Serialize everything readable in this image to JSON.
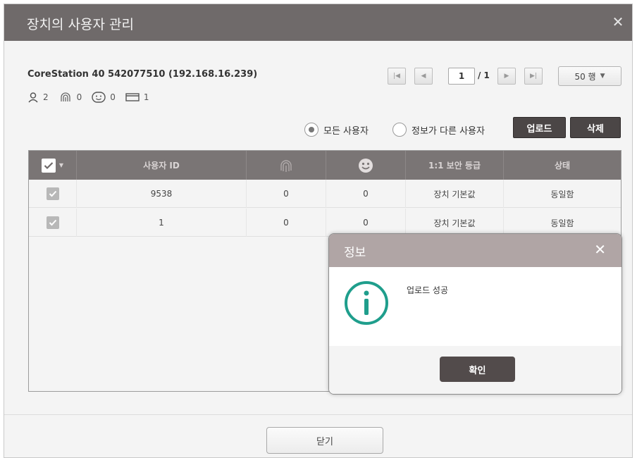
{
  "window": {
    "title": "장치의 사용자 관리",
    "close_glyph": "✕"
  },
  "device": {
    "name": "CoreStation 40 542077510 (192.168.16.239)",
    "counts": {
      "users": "2",
      "fingerprints": "0",
      "faces": "0",
      "cards": "1"
    }
  },
  "pagination": {
    "page": "1",
    "total": "/ 1",
    "rows_per_page": "50 행"
  },
  "filter": {
    "all_users": "모든 사용자",
    "different_users": "정보가 다른 사용자",
    "selected": "all_users"
  },
  "actions": {
    "upload": "업로드",
    "delete": "삭제"
  },
  "table": {
    "columns": [
      "사용자 ID",
      "fingerprint-icon",
      "face-icon",
      "1:1 보안 등급",
      "상태"
    ],
    "headers": {
      "user_id": "사용자 ID",
      "security": "1:1 보안 등급",
      "status": "상태"
    },
    "rows": [
      {
        "checked": true,
        "user_id": "9538",
        "fingerprint": "0",
        "face": "0",
        "security": "장치 기본값",
        "status": "동일함"
      },
      {
        "checked": true,
        "user_id": "1",
        "fingerprint": "0",
        "face": "0",
        "security": "장치 기본값",
        "status": "동일함"
      }
    ]
  },
  "footer": {
    "close": "닫기"
  },
  "message_box": {
    "title": "정보",
    "close_glyph": "✕",
    "message": "업로드 성공",
    "ok": "확인"
  },
  "colors": {
    "titlebar": "#6f6a6a",
    "table_header": "#7a7575",
    "dark_button": "#4b4646",
    "info_teal": "#1f9e8c",
    "msg_title": "#b0a5a5"
  }
}
